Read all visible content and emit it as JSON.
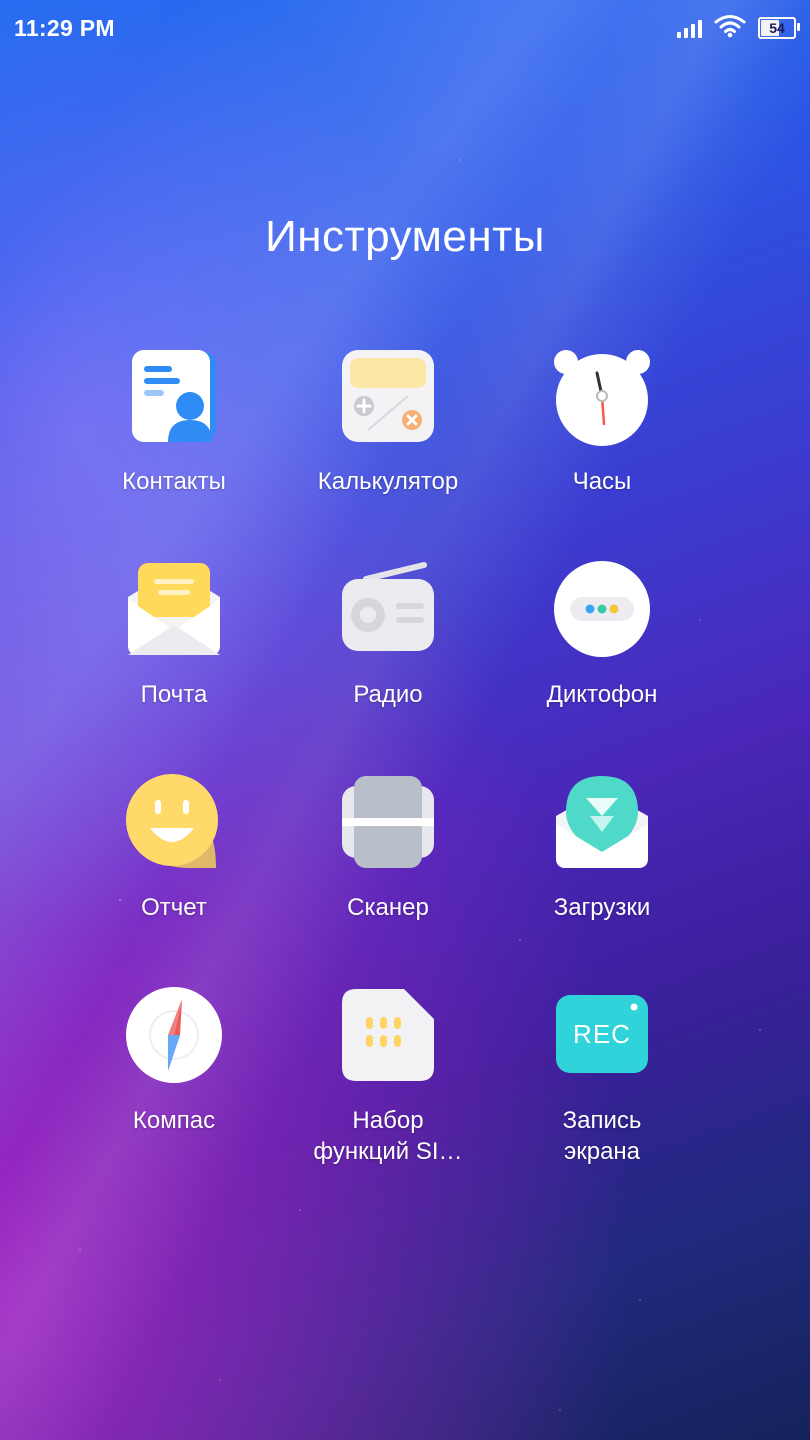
{
  "status_bar": {
    "time": "11:29 PM",
    "battery_level": "54",
    "signal_bars": 4,
    "wifi": true
  },
  "folder": {
    "title": "Инструменты"
  },
  "apps": [
    {
      "label": "Контакты",
      "icon": "contacts-icon"
    },
    {
      "label": "Калькулятор",
      "icon": "calculator-icon"
    },
    {
      "label": "Часы",
      "icon": "clock-icon"
    },
    {
      "label": "Почта",
      "icon": "mail-icon"
    },
    {
      "label": "Радио",
      "icon": "radio-icon"
    },
    {
      "label": "Диктофон",
      "icon": "recorder-icon"
    },
    {
      "label": "Отчет",
      "icon": "feedback-icon"
    },
    {
      "label": "Сканер",
      "icon": "scanner-icon"
    },
    {
      "label": "Загрузки",
      "icon": "downloads-icon"
    },
    {
      "label": "Компас",
      "icon": "compass-icon"
    },
    {
      "label": "Набор\nфункций SI…",
      "icon": "sim-toolkit-icon"
    },
    {
      "label": "Запись\nэкрана",
      "icon": "screen-recorder-icon"
    }
  ],
  "colors": {
    "accent_blue": "#2f8cf5",
    "accent_yellow": "#ffd95a",
    "accent_teal": "#2fd3d9"
  }
}
